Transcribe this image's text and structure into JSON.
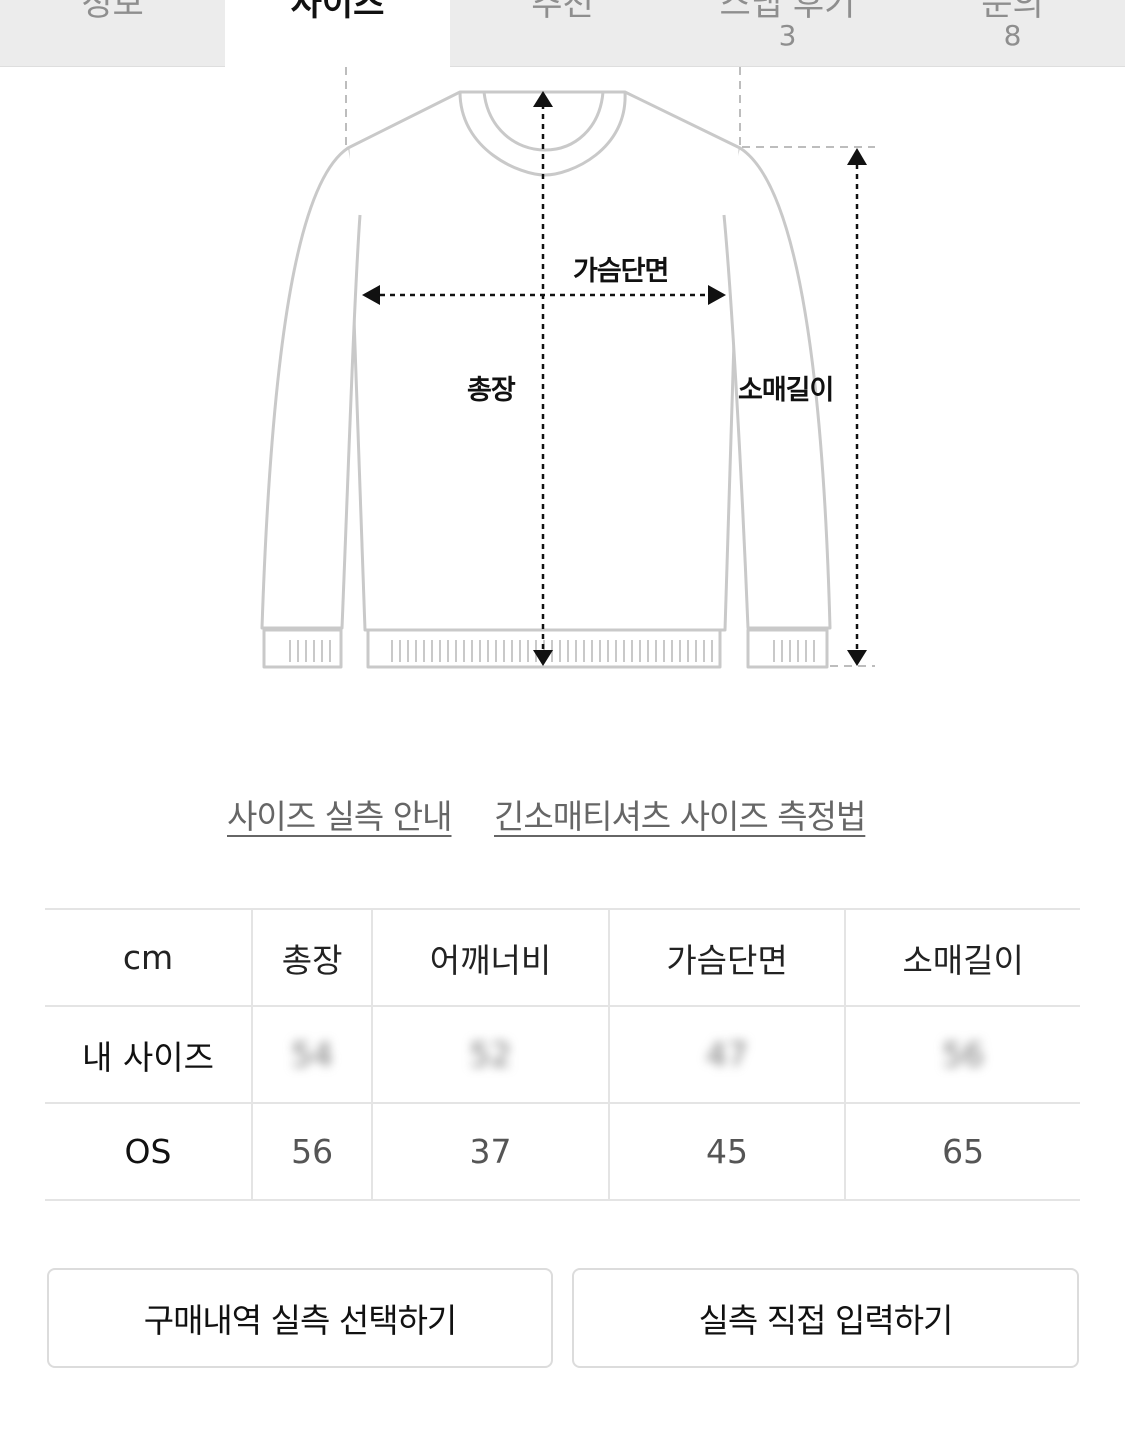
{
  "tabs": [
    {
      "label": "정보",
      "count": ""
    },
    {
      "label": "사이즈",
      "count": ""
    },
    {
      "label": "추천",
      "count": ""
    },
    {
      "label": "스냅 후기",
      "count": "3"
    },
    {
      "label": "문의",
      "count": "8"
    }
  ],
  "diagram": {
    "chest_label": "가슴단면",
    "length_label": "총장",
    "sleeve_label": "소매길이"
  },
  "links": {
    "size_guide": "사이즈 실측 안내",
    "measure_method": "긴소매티셔츠 사이즈 측정법"
  },
  "size_table": {
    "headers": [
      "cm",
      "총장",
      "어깨너비",
      "가슴단면",
      "소매길이"
    ],
    "rows": [
      {
        "label": "내 사이즈",
        "values": [
          "54",
          "52",
          "47",
          "56"
        ]
      },
      {
        "label": "OS",
        "values": [
          "56",
          "37",
          "45",
          "65"
        ]
      }
    ]
  },
  "buttons": {
    "purchase_history": "구매내역 실측 선택하기",
    "manual_input": "실측 직접 입력하기"
  }
}
